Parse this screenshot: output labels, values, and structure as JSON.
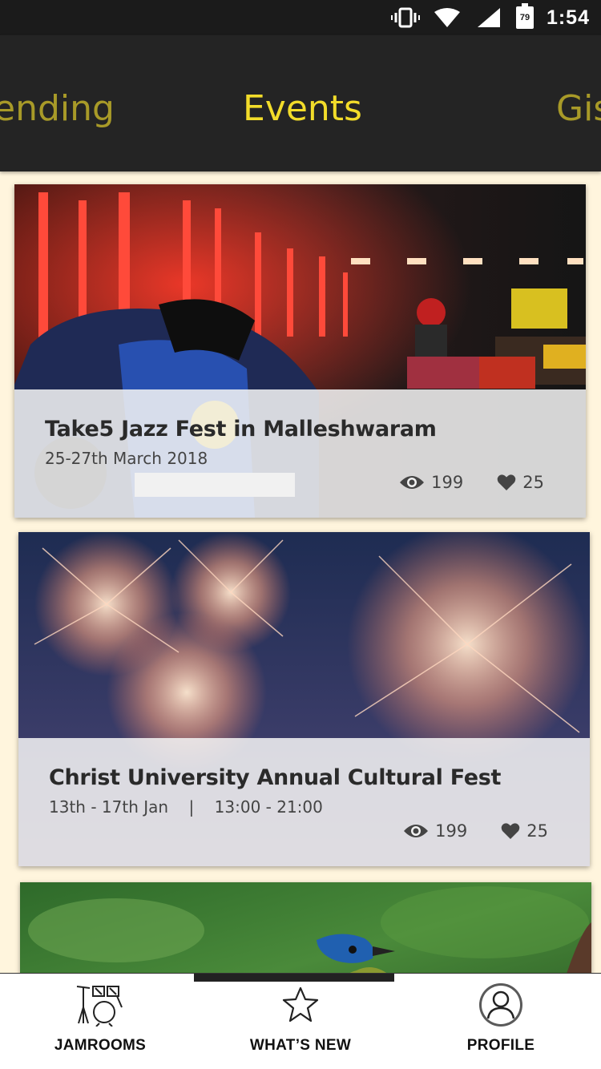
{
  "status_bar": {
    "time": "1:54",
    "battery_level": "79",
    "icons": [
      "vibrate-icon",
      "wifi-icon",
      "cell-signal-icon",
      "battery-icon"
    ]
  },
  "tabs": [
    {
      "label": "ending",
      "active": false
    },
    {
      "label": "Events",
      "active": true
    },
    {
      "label": "Gis",
      "active": false
    }
  ],
  "events": [
    {
      "title": "Take5 Jazz Fest in Malleshwaram",
      "date": "25-27th March 2018",
      "views": "199",
      "likes": "25"
    },
    {
      "title": "Christ University Annual Cultural Fest",
      "date": "13th - 17th Jan    |    13:00 - 21:00",
      "views": "199",
      "likes": "25"
    }
  ],
  "bottom_nav": [
    {
      "label": "JAMROOMS",
      "icon": "drum-kit-icon"
    },
    {
      "label": "WHAT’S NEW",
      "icon": "star-icon"
    },
    {
      "label": "PROFILE",
      "icon": "profile-icon"
    }
  ],
  "colors": {
    "header_bg": "#242424",
    "tab_active": "#f2dc2a",
    "tab_inactive": "#a89a28",
    "page_bg": "#fff5dd"
  }
}
